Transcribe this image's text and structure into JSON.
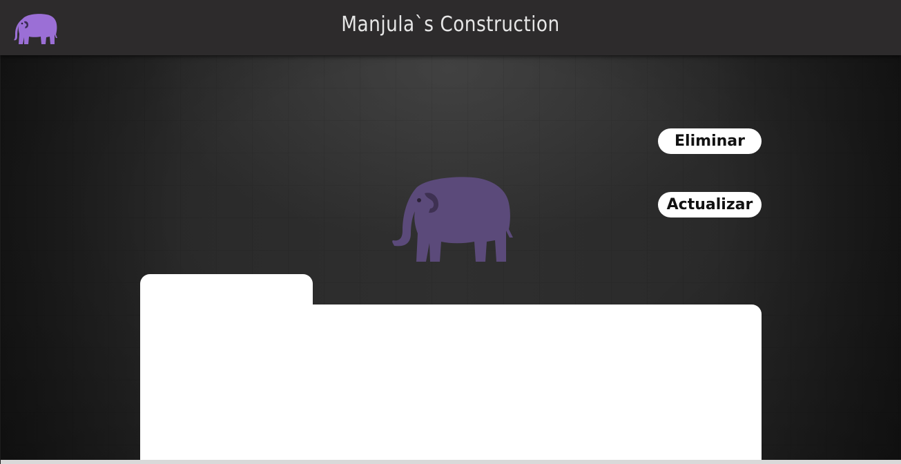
{
  "header": {
    "title": "Manjula`s Construction",
    "logo_icon": "elephant-icon",
    "logo_color": "#9b6fd6"
  },
  "actions": {
    "delete_label": "Eliminar",
    "update_label": "Actualizar"
  },
  "hero": {
    "icon": "elephant-icon",
    "color": "#5b4a7a"
  },
  "colors": {
    "header_bg": "#2d2b2c",
    "stage_bg": "#2a2a2a",
    "panel_bg": "#ffffff"
  }
}
